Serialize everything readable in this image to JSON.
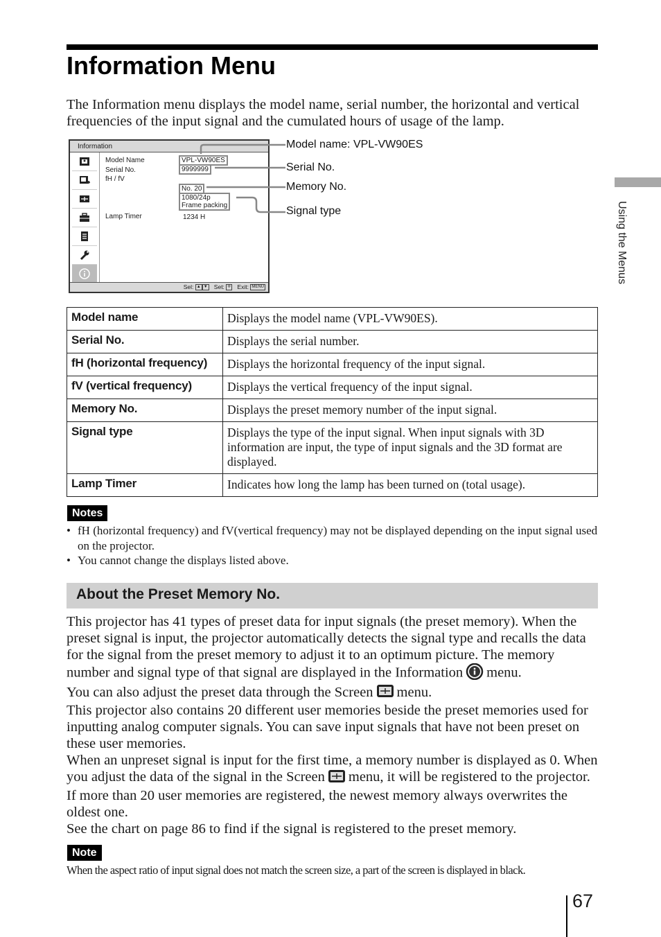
{
  "page": {
    "title": "Information Menu",
    "intro": "The Information menu displays the model name, serial number, the horizontal and vertical frequencies of the input signal and the cumulated hours of usage of the lamp.",
    "page_number": "67",
    "side_label": "Using the Menus"
  },
  "osd": {
    "header": "Information",
    "sidebar_icons": [
      "picture-icon",
      "advanced-picture-icon",
      "screen-icon",
      "setup-icon",
      "function-icon",
      "installation-icon",
      "information-icon"
    ],
    "rows": [
      {
        "label": "Model Name",
        "value": "VPL-VW90ES"
      },
      {
        "label": "Serial No.",
        "value": "9999999"
      },
      {
        "label": "fH / fV",
        "value": ""
      },
      {
        "label": "",
        "value": "No. 20"
      },
      {
        "label": "",
        "value": "1080/24p"
      },
      {
        "label": "",
        "value": "Frame packing"
      },
      {
        "label": "Lamp Timer",
        "value": "1234 H"
      }
    ],
    "footer": {
      "sel": "Sel:",
      "set": "Set:",
      "exit": "Exit:",
      "menu_key": "MENU"
    }
  },
  "callouts": [
    "Model name: VPL-VW90ES",
    "Serial No.",
    "Memory No.",
    "Signal type"
  ],
  "table": [
    {
      "item": "Model name",
      "desc": "Displays the model name (VPL-VW90ES)."
    },
    {
      "item": "Serial No.",
      "desc": "Displays the serial number."
    },
    {
      "item": "fH (horizontal frequency)",
      "desc": "Displays the horizontal frequency of the input signal."
    },
    {
      "item": "fV (vertical frequency)",
      "desc": "Displays the vertical frequency of the input signal."
    },
    {
      "item": "Memory No.",
      "desc": "Displays the preset memory number of the input signal."
    },
    {
      "item": "Signal type",
      "desc": "Displays the type of the input signal. When input signals with 3D information are input, the type of input signals and the 3D format are displayed."
    },
    {
      "item": "Lamp Timer",
      "desc": "Indicates how long the lamp has been turned on (total usage)."
    }
  ],
  "notes": {
    "label": "Notes",
    "items": [
      "fH (horizontal frequency) and fV(vertical frequency) may not be displayed depending on the input signal used on the projector.",
      "You cannot change the displays listed above."
    ]
  },
  "section": {
    "title": "About the Preset Memory No.",
    "p1a": "This projector has 41 types of preset data for input signals (the preset memory). When the preset signal is input, the projector automatically detects the signal type and recalls the data for the signal from the preset memory to adjust it to an optimum picture. The memory number and signal type of that signal are displayed in the Information",
    "p1b": "menu.",
    "p2a": "You can also adjust the preset data through the Screen",
    "p2b": "menu.",
    "p3": "This projector also contains 20 different user memories beside the preset memories used for inputting analog computer signals. You can save input signals that have not been preset on these user memories.",
    "p4a": "When an unpreset signal is input for the first time, a memory number is displayed as 0. When you adjust the data of the signal in the Screen",
    "p4b": "menu, it will be registered to the projector. If more than 20 user memories are registered, the newest memory always overwrites the oldest one.",
    "p5": "See the chart on page 86 to find if the signal is registered to the preset memory."
  },
  "note": {
    "label": "Note",
    "text": "When the aspect ratio of input signal does not match the screen size, a part of the screen is displayed in black."
  }
}
